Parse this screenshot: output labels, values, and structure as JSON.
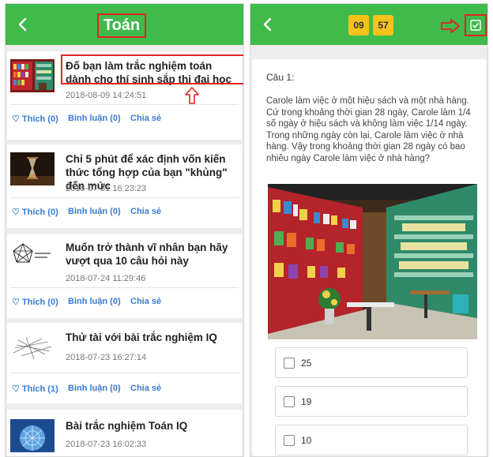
{
  "left": {
    "header": {
      "title": "Toán",
      "back_icon": "back-chevron-icon"
    },
    "articles": [
      {
        "title": "Đố bạn làm trắc nghiệm toán dành cho thí sinh sắp thi đại học",
        "date": "2018-08-09 14:24:51",
        "like": "Thích (0)",
        "comment": "Bình luận (0)",
        "share": "Chia sẻ",
        "thumb": "bookstore"
      },
      {
        "title": "Chỉ 5 phút để xác định vốn kiến thức tổng hợp của bạn \"khủng\" đến mức",
        "date": "2018-07-31 16:23:23",
        "like": "Thích (0)",
        "comment": "Bình luận (0)",
        "share": "Chia sẻ",
        "thumb": "hourglass"
      },
      {
        "title": "Muốn trở thành vĩ nhân bạn hãy vượt qua 10 câu hỏi này",
        "date": "2018-07-24 11:29:46",
        "like": "Thích (0)",
        "comment": "Bình luận (0)",
        "share": "Chia sẻ",
        "thumb": "pentagon"
      },
      {
        "title": "Thử tài với bài trắc nghiệm IQ",
        "date": "2018-07-23 16:27:14",
        "like": "Thích (1)",
        "comment": "Bình luận (0)",
        "share": "Chia sẻ",
        "thumb": "sticks"
      },
      {
        "title": "Bài trắc nghiệm Toán IQ",
        "date": "2018-07-23 16:02:33",
        "thumb": "sphere"
      }
    ]
  },
  "right": {
    "timer": {
      "minutes": "09",
      "seconds": "57"
    },
    "question": {
      "number": "Câu 1:",
      "text": "Carole làm việc ở một hiệu sách và một nhà hàng. Cứ trong khoảng thời gian 28 ngày, Carole làm 1/4 số ngày ở hiệu sách và không làm việc 1/14 ngày. Trong những ngày còn lại, Carole làm việc ở nhà hàng. Vậy trong khoảng thời gian 28 ngày có bao nhiêu ngày Carole làm việc ở nhà hàng?",
      "options": [
        "25",
        "19",
        "10"
      ]
    }
  },
  "colors": {
    "header_green": "#3fba4b",
    "timer_yellow": "#f4c21a",
    "annotation_red": "#e02424",
    "link_blue": "#3a7bd5"
  }
}
